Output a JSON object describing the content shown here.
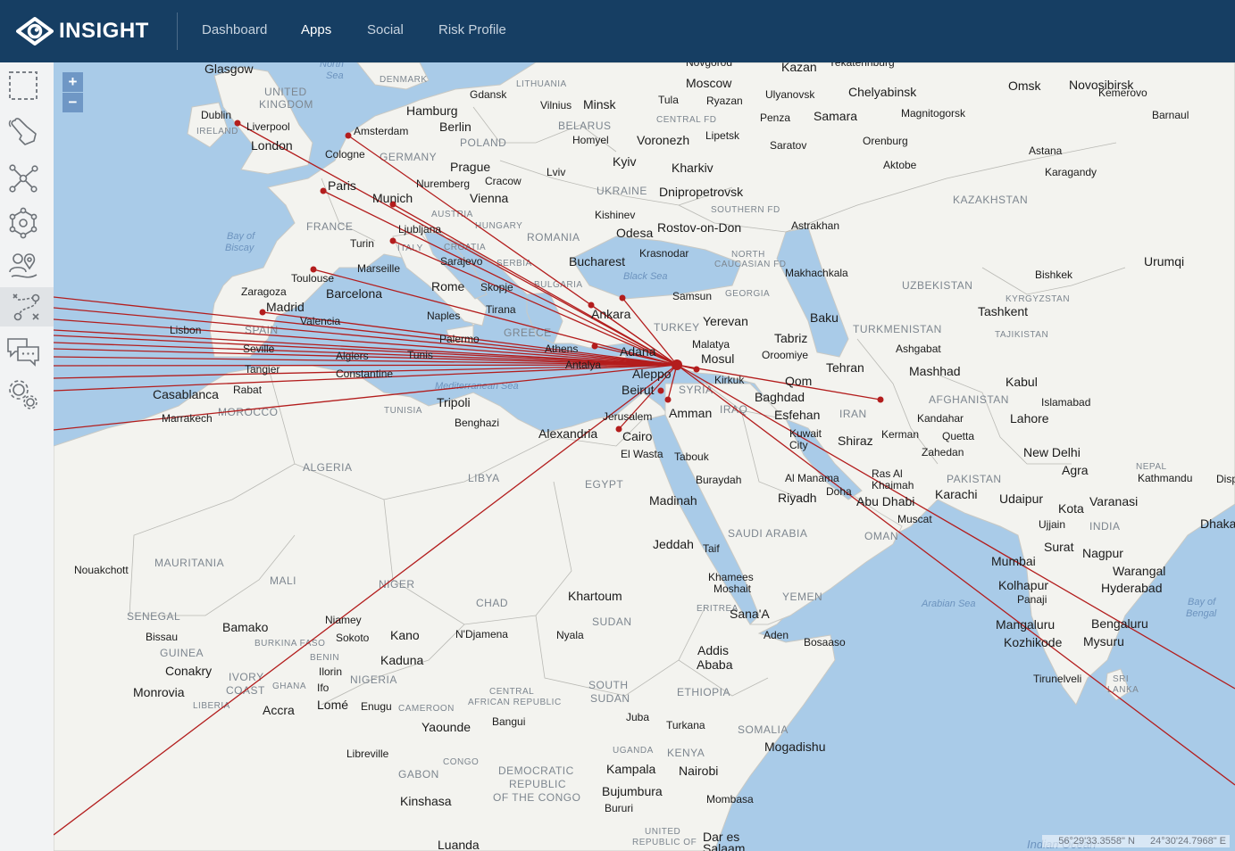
{
  "app": {
    "logo_text": "INSIGHT"
  },
  "nav": [
    {
      "label": "Dashboard",
      "active": false
    },
    {
      "label": "Apps",
      "active": true
    },
    {
      "label": "Social",
      "active": false
    },
    {
      "label": "Risk Profile",
      "active": false
    }
  ],
  "tools": [
    {
      "name": "select-area-tool",
      "icon": "dashed-square-icon"
    },
    {
      "name": "hand-touch-tool",
      "icon": "hand-pointer-icon"
    },
    {
      "name": "network-tool",
      "icon": "network-graph-icon"
    },
    {
      "name": "cluster-tool",
      "icon": "cluster-icon"
    },
    {
      "name": "people-location-tool",
      "icon": "people-pin-icon"
    },
    {
      "name": "route-tool",
      "icon": "route-icon"
    },
    {
      "name": "chat-tool",
      "icon": "chat-bubbles-icon"
    },
    {
      "name": "settings-tool",
      "icon": "gears-icon"
    }
  ],
  "active_tool": "route-tool",
  "zoom": {
    "in_label": "+",
    "out_label": "−"
  },
  "coords": {
    "lat": "56°29'33.3558\" N",
    "lon": "24°30'24.7968\" E"
  },
  "colors": {
    "header": "#163e63",
    "route": "#b31d1d",
    "water": "#a9cbe8",
    "land": "#f3f3ef",
    "zoom_button": "#6f97c5"
  },
  "map": {
    "hub_label": "Aleppo",
    "country_labels": [
      "UNITED KINGDOM",
      "IRELAND",
      "DENMARK",
      "LITHUANIA",
      "BELARUS",
      "POLAND",
      "GERMANY",
      "UKRAINE",
      "FRANCE",
      "AUSTRIA",
      "HUNGARY",
      "CROATIA",
      "SERBIA",
      "ROMANIA",
      "BULGARIA",
      "ITALY",
      "SPAIN",
      "GREECE",
      "TURKEY",
      "GEORGIA",
      "SYRIA",
      "IRAQ",
      "IRAN",
      "TURKMENISTAN",
      "UZBEKISTAN",
      "KAZAKHSTAN",
      "KYRGYZSTAN",
      "TAJIKISTAN",
      "AFGHANISTAN",
      "PAKISTAN",
      "INDIA",
      "NEPAL",
      "MOROCCO",
      "ALGERIA",
      "TUNISIA",
      "LIBYA",
      "EGYPT",
      "SAUDI ARABIA",
      "OMAN",
      "YEMEN",
      "ERITREA",
      "ETHIOPIA",
      "SOMALIA",
      "KENYA",
      "SUDAN",
      "SOUTH SUDAN",
      "CHAD",
      "NIGER",
      "MALI",
      "MAURITANIA",
      "SENEGAL",
      "GUINEA",
      "IVORY COAST",
      "GHANA",
      "LIBERIA",
      "BURKINA FASO",
      "NIGERIA",
      "BENIN",
      "CAMEROON",
      "CENTRAL AFRICAN REPUBLIC",
      "GABON",
      "CONGO",
      "DEMOCRATIC REPUBLIC OF THE CONGO",
      "UGANDA",
      "UNITED REPUBLIC OF",
      "SRI LANKA",
      "CENTRAL FD",
      "SOUTHERN FD",
      "NORTH CAUCASIAN FD"
    ],
    "sea_labels": [
      "North Sea",
      "Bay of Biscay",
      "Black Sea",
      "Mediterranean Sea",
      "Arabian Sea",
      "Bay of Bengal",
      "Indian Ocean"
    ],
    "city_labels": [
      "Glasgow",
      "Dublin",
      "Liverpool",
      "London",
      "Amsterdam",
      "Hamburg",
      "Gdansk",
      "Vilnius",
      "Minsk",
      "Berlin",
      "Cologne",
      "Paris",
      "Prague",
      "Cracow",
      "Nuremberg",
      "Munich",
      "Vienna",
      "Lviv",
      "Homyel",
      "Kyiv",
      "Kharkiv",
      "Voronezh",
      "Lipetsk",
      "Tula",
      "Ryazan",
      "Moscow",
      "Novgorod",
      "Kazan",
      "Yekaterinburg",
      "Ulyanovsk",
      "Chelyabinsk",
      "Magnitogorsk",
      "Penza",
      "Samara",
      "Saratov",
      "Orenburg",
      "Aktobe",
      "Omsk",
      "Novosibirsk",
      "Kemerovo",
      "Barnaul",
      "Astana",
      "Karagandy",
      "Dnipropetrovsk",
      "Kishinev",
      "Odesa",
      "Rostov-on-Don",
      "Krasnodar",
      "Astrakhan",
      "Bucharest",
      "Ljubljana",
      "Sarajevo",
      "Turin",
      "Marseille",
      "Toulouse",
      "Zaragoza",
      "Barcelona",
      "Madrid",
      "Valencia",
      "Lisbon",
      "Seville",
      "Tangier",
      "Rabat",
      "Casablanca",
      "Marrakech",
      "Algiers",
      "Constantine",
      "Tunis",
      "Rome",
      "Naples",
      "Palermo",
      "Skopje",
      "Tirana",
      "Athens",
      "Ankara",
      "Samsun",
      "Adana",
      "Antalya",
      "Malatya",
      "Yerevan",
      "Tabriz",
      "Oroomiye",
      "Baku",
      "Makhachkala",
      "Mosul",
      "Kirkuk",
      "Tehran",
      "Qom",
      "Mashhad",
      "Ashgabat",
      "Aleppo",
      "Beirut",
      "Jerusalem",
      "Amman",
      "Baghdad",
      "Esfehan",
      "Shiraz",
      "Kerman",
      "Kuwait City",
      "Tashkent",
      "Bishkek",
      "Urumqi",
      "Kabul",
      "Islamabad",
      "Lahore",
      "Kandahar",
      "Quetta",
      "Zahedan",
      "New Delhi",
      "Agra",
      "Kathmandu",
      "Karachi",
      "Udaipur",
      "Kota",
      "Varanasi",
      "Ujjain",
      "Dhaka",
      "Surat",
      "Nagpur",
      "Mumbai",
      "Warangal",
      "Hyderabad",
      "Kolhapur",
      "Panaji",
      "Bengaluru",
      "Mangaluru",
      "Mysuru",
      "Kozhikode",
      "Tirunelveli",
      "Tripoli",
      "Benghazi",
      "Alexandria",
      "Cairo",
      "El Wasta",
      "Tabouk",
      "Buraydah",
      "Madinah",
      "Al Manama",
      "Doha",
      "Ras Al Khaimah",
      "Riyadh",
      "Abu Dhabi",
      "Muscat",
      "Jeddah",
      "Taif",
      "Khamees Moshait",
      "Sana'A",
      "Aden",
      "Bosaaso",
      "Khartoum",
      "Addis Ababa",
      "Nyala",
      "N'Djamena",
      "Kano",
      "Kaduna",
      "Niamey",
      "Sokoto",
      "Ilorin",
      "Ifo",
      "Lomé",
      "Enugu",
      "Accra",
      "Bamako",
      "Bissau",
      "Conakry",
      "Monrovia",
      "Nouakchott",
      "Yaounde",
      "Bangui",
      "Libreville",
      "Kinshasa",
      "Luanda",
      "Juba",
      "Turkana",
      "Kampala",
      "Nairobi",
      "Bujumbura",
      "Bururi",
      "Mombasa",
      "Dar es Salaam",
      "Mogadishu",
      "Disp"
    ]
  }
}
